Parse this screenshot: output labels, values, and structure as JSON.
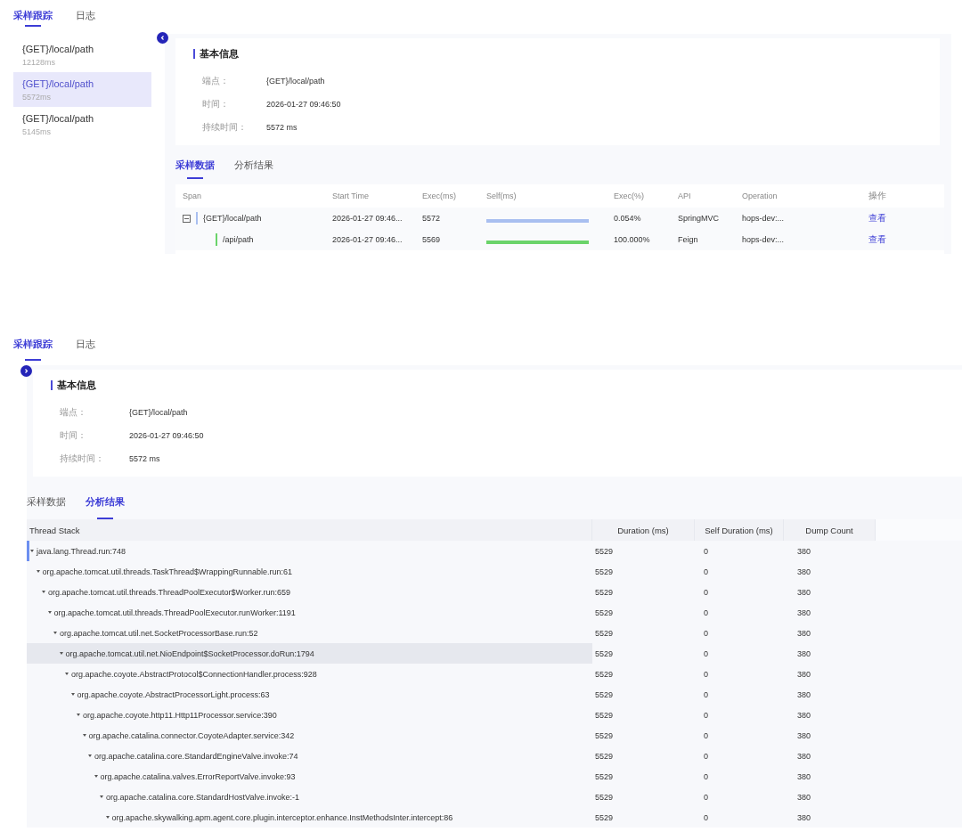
{
  "views": [
    {
      "tabs": [
        {
          "label": "采样跟踪",
          "selected": true
        },
        {
          "label": "日志",
          "selected": false
        }
      ],
      "sidebar_collapsed": false,
      "traces": [
        {
          "endpoint": "{GET}/local/path",
          "duration": "12128ms",
          "selected": false
        },
        {
          "endpoint": "{GET}/local/path",
          "duration": "5572ms",
          "selected": true
        },
        {
          "endpoint": "{GET}/local/path",
          "duration": "5145ms",
          "selected": false
        }
      ],
      "info": {
        "title": "基本信息",
        "fields": [
          {
            "label": "端点：",
            "value": "{GET}/local/path"
          },
          {
            "label": "时间：",
            "value": "2026-01-27 09:46:50"
          },
          {
            "label": "持续时间：",
            "value": "5572 ms"
          }
        ]
      },
      "subtabs": [
        {
          "label": "采样数据",
          "selected": true
        },
        {
          "label": "分析结果",
          "selected": false
        }
      ],
      "span_table": {
        "columns": [
          "Span",
          "Start Time",
          "Exec(ms)",
          "Self(ms)",
          "Exec(%)",
          "API",
          "Operation",
          "操作"
        ],
        "rows": [
          {
            "span": "{GET}/local/path",
            "start_time": "2026-01-27 09:46...",
            "exec_ms": "5572",
            "level": 1,
            "exec_pct": "0.054%",
            "api": "SpringMVC",
            "operation": "hops-dev:...",
            "action": "查看",
            "color": "#a9bff0",
            "expanded": true,
            "children": [
              {
                "span": "/api/path",
                "start_time": "2026-01-27 09:46...",
                "exec_ms": "5569",
                "level": 1,
                "exec_pct": "100.000%",
                "api": "Feign",
                "operation": "hops-dev:...",
                "action": "查看",
                "color": "#6ad36a"
              }
            ]
          }
        ]
      }
    },
    {
      "tabs": [
        {
          "label": "采样跟踪",
          "selected": true
        },
        {
          "label": "日志",
          "selected": false
        }
      ],
      "sidebar_collapsed": true,
      "info": {
        "title": "基本信息",
        "fields": [
          {
            "label": "端点：",
            "value": "{GET}/local/path"
          },
          {
            "label": "时间：",
            "value": "2026-01-27 09:46:50"
          },
          {
            "label": "持续时间：",
            "value": "5572 ms"
          }
        ]
      },
      "subtabs": [
        {
          "label": "采样数据",
          "selected": false
        },
        {
          "label": "分析结果",
          "selected": true
        }
      ],
      "thread_stack": {
        "columns": [
          "Thread Stack",
          "Duration (ms)",
          "Self Duration (ms)",
          "Dump Count"
        ],
        "rows": [
          {
            "method": "java.lang.Thread.run:748",
            "duration": "5529",
            "self_duration": "0",
            "dump_count": "380",
            "expanded": true,
            "selected": false,
            "focused": true,
            "children": [
              {
                "method": "org.apache.tomcat.util.threads.TaskThread$WrappingRunnable.run:61",
                "duration": "5529",
                "self_duration": "0",
                "dump_count": "380",
                "expanded": true,
                "selected": false,
                "focused": false,
                "children": [
                  {
                    "method": "org.apache.tomcat.util.threads.ThreadPoolExecutor$Worker.run:659",
                    "duration": "5529",
                    "self_duration": "0",
                    "dump_count": "380",
                    "expanded": true,
                    "selected": false,
                    "focused": false,
                    "children": [
                      {
                        "method": "org.apache.tomcat.util.threads.ThreadPoolExecutor.runWorker:1191",
                        "duration": "5529",
                        "self_duration": "0",
                        "dump_count": "380",
                        "expanded": true,
                        "selected": false,
                        "focused": false,
                        "children": [
                          {
                            "method": "org.apache.tomcat.util.net.SocketProcessorBase.run:52",
                            "duration": "5529",
                            "self_duration": "0",
                            "dump_count": "380",
                            "expanded": true,
                            "selected": false,
                            "focused": false,
                            "children": [
                              {
                                "method": "org.apache.tomcat.util.net.NioEndpoint$SocketProcessor.doRun:1794",
                                "duration": "5529",
                                "self_duration": "0",
                                "dump_count": "380",
                                "expanded": true,
                                "selected": true,
                                "focused": false,
                                "children": [
                                  {
                                    "method": "org.apache.coyote.AbstractProtocol$ConnectionHandler.process:928",
                                    "duration": "5529",
                                    "self_duration": "0",
                                    "dump_count": "380",
                                    "expanded": true,
                                    "selected": false,
                                    "focused": false,
                                    "children": [
                                      {
                                        "method": "org.apache.coyote.AbstractProcessorLight.process:63",
                                        "duration": "5529",
                                        "self_duration": "0",
                                        "dump_count": "380",
                                        "expanded": true,
                                        "selected": false,
                                        "focused": false,
                                        "children": [
                                          {
                                            "method": "org.apache.coyote.http11.Http11Processor.service:390",
                                            "duration": "5529",
                                            "self_duration": "0",
                                            "dump_count": "380",
                                            "expanded": true,
                                            "selected": false,
                                            "focused": false,
                                            "children": [
                                              {
                                                "method": "org.apache.catalina.connector.CoyoteAdapter.service:342",
                                                "duration": "5529",
                                                "self_duration": "0",
                                                "dump_count": "380",
                                                "expanded": true,
                                                "selected": false,
                                                "focused": false,
                                                "children": [
                                                  {
                                                    "method": "org.apache.catalina.core.StandardEngineValve.invoke:74",
                                                    "duration": "5529",
                                                    "self_duration": "0",
                                                    "dump_count": "380",
                                                    "expanded": true,
                                                    "selected": false,
                                                    "focused": false,
                                                    "children": [
                                                      {
                                                        "method": "org.apache.catalina.valves.ErrorReportValve.invoke:93",
                                                        "duration": "5529",
                                                        "self_duration": "0",
                                                        "dump_count": "380",
                                                        "expanded": true,
                                                        "selected": false,
                                                        "focused": false,
                                                        "children": [
                                                          {
                                                            "method": "org.apache.catalina.core.StandardHostValve.invoke:-1",
                                                            "duration": "5529",
                                                            "self_duration": "0",
                                                            "dump_count": "380",
                                                            "expanded": true,
                                                            "selected": false,
                                                            "focused": false,
                                                            "children": [
                                                              {
                                                                "method": "org.apache.skywalking.apm.agent.core.plugin.interceptor.enhance.InstMethodsInter.intercept:86",
                                                                "duration": "5529",
                                                                "self_duration": "0",
                                                                "dump_count": "380",
                                                                "expanded": true,
                                                                "selected": false,
                                                                "focused": false
                                                              }
                                                            ]
                                                          }
                                                        ]
                                                      }
                                                    ]
                                                  }
                                                ]
                                              }
                                            ]
                                          }
                                        ]
                                      }
                                    ]
                                  }
                                ]
                              }
                            ]
                          }
                        ]
                      }
                    ]
                  }
                ]
              }
            ]
          }
        ]
      }
    }
  ]
}
